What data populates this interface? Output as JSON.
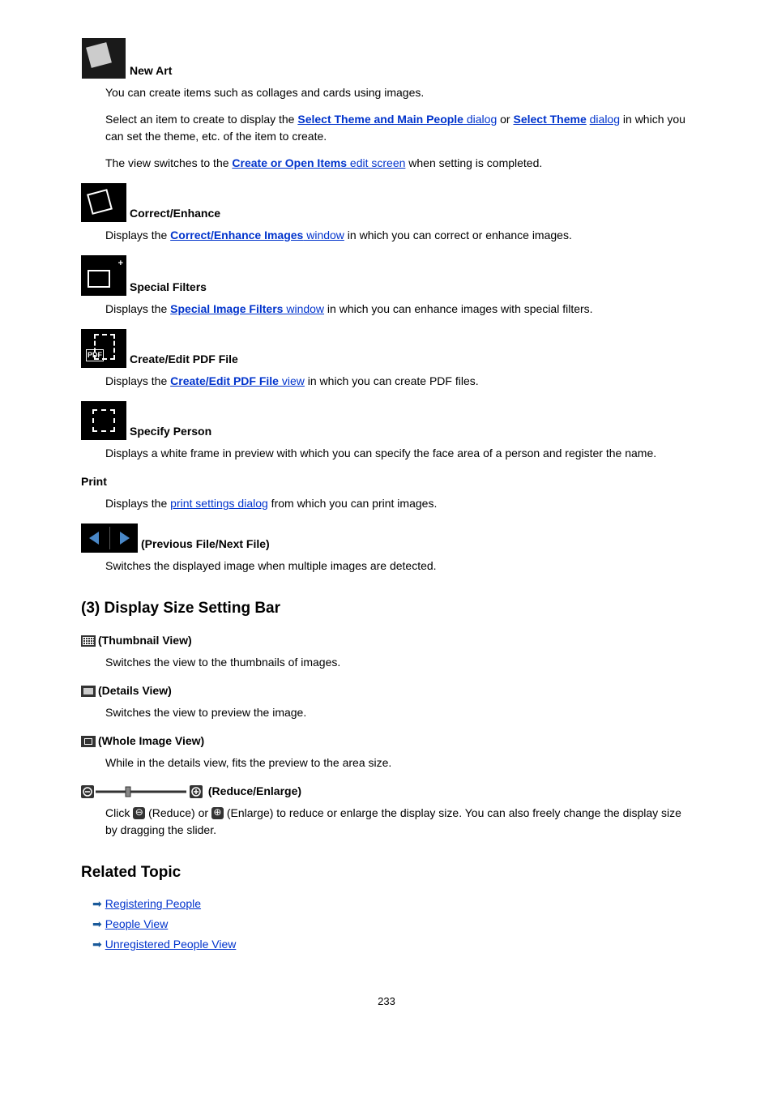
{
  "newArt": {
    "label": "New Art",
    "p1": "You can create items such as collages and cards using images.",
    "p2_pre": "Select an item to create to display the ",
    "p2_link1": "Select Theme and Main People",
    "p2_link1_suffix": " dialog",
    "p2_mid": " or ",
    "p2_link2": "Select Theme",
    "p2_link2_line2": "dialog",
    "p2_post": " in which you can set the theme, etc. of the item to create.",
    "p3_pre": "The view switches to the ",
    "p3_link": "Create or Open Items",
    "p3_link_suffix": " edit screen",
    "p3_post": " when setting is completed."
  },
  "correctEnhance": {
    "label": "Correct/Enhance",
    "pre": "Displays the ",
    "link": "Correct/Enhance Images",
    "link_suffix": " window",
    "post": " in which you can correct or enhance images."
  },
  "specialFilters": {
    "label": "Special Filters",
    "pre": "Displays the ",
    "link": "Special Image Filters",
    "link_suffix": " window",
    "post": " in which you can enhance images with special filters."
  },
  "pdf": {
    "label": "Create/Edit PDF File",
    "pre": "Displays the ",
    "link": "Create/Edit PDF File",
    "link_suffix": " view",
    "post": " in which you can create PDF files."
  },
  "specifyPerson": {
    "label": "Specify Person",
    "text": "Displays a white frame in preview with which you can specify the face area of a person and register the name."
  },
  "print": {
    "label": "Print",
    "pre": "Displays the ",
    "link": "print settings dialog",
    "post": " from which you can print images."
  },
  "prevNext": {
    "label": "(Previous File/Next File)",
    "text": "Switches the displayed image when multiple images are detected."
  },
  "section3": {
    "heading": "(3) Display Size Setting Bar"
  },
  "thumbnailView": {
    "label": "(Thumbnail View)",
    "text": "Switches the view to the thumbnails of images."
  },
  "detailsView": {
    "label": "(Details View)",
    "text": "Switches the view to preview the image."
  },
  "wholeImageView": {
    "label": "(Whole Image View)",
    "text": "While in the details view, fits the preview to the area size."
  },
  "reduceEnlarge": {
    "label": "(Reduce/Enlarge)",
    "pre": "Click ",
    "mid1": " (Reduce) or ",
    "mid2": " (Enlarge) to reduce or enlarge the display size. You can also freely change the display size by dragging the slider."
  },
  "relatedTopic": {
    "heading": "Related Topic",
    "links": [
      "Registering People",
      "People View",
      "Unregistered People View"
    ]
  },
  "pageNumber": "233"
}
